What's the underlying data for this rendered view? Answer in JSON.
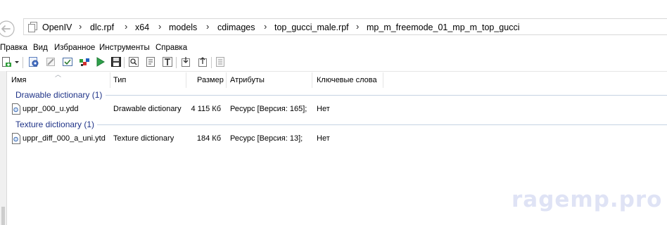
{
  "address": {
    "crumbs": [
      "OpenIV",
      "dlc.rpf",
      "x64",
      "models",
      "cdimages",
      "top_gucci_male.rpf",
      "mp_m_freemode_01_mp_m_top_gucci"
    ],
    "separator": "›"
  },
  "menu": [
    "Правка",
    "Вид",
    "Избранное",
    "Инструменты",
    "Справка"
  ],
  "toolbar": {
    "icons": [
      "new-icon",
      "dropdown-arrow-icon",
      "settings-gear-icon",
      "tools-icon",
      "checkbox-icon",
      "colors-icon",
      "play-icon",
      "save-icon",
      "search-icon",
      "page-icon",
      "text-icon",
      "import-icon",
      "export-icon",
      "list-icon"
    ]
  },
  "columns": {
    "name": "Имя",
    "type": "Тип",
    "size": "Размер",
    "attributes": "Атрибуты",
    "keywords": "Ключевые слова"
  },
  "groups": [
    {
      "title": "Drawable dictionary (1)",
      "rows": [
        {
          "name": "uppr_000_u.ydd",
          "type": "Drawable dictionary",
          "size": "4 115 Кб",
          "attributes": "Ресурс [Версия: 165];",
          "keywords": "Нет"
        }
      ]
    },
    {
      "title": "Texture dictionary (1)",
      "rows": [
        {
          "name": "uppr_diff_000_a_uni.ytd",
          "type": "Texture dictionary",
          "size": "184 Кб",
          "attributes": "Ресурс [Версия: 13];",
          "keywords": "Нет"
        }
      ]
    }
  ],
  "watermark": "ragemp.pro",
  "colors": {
    "group_title": "#1e3287",
    "group_line": "#c5d3e3",
    "watermark": "#dfe3f5"
  }
}
